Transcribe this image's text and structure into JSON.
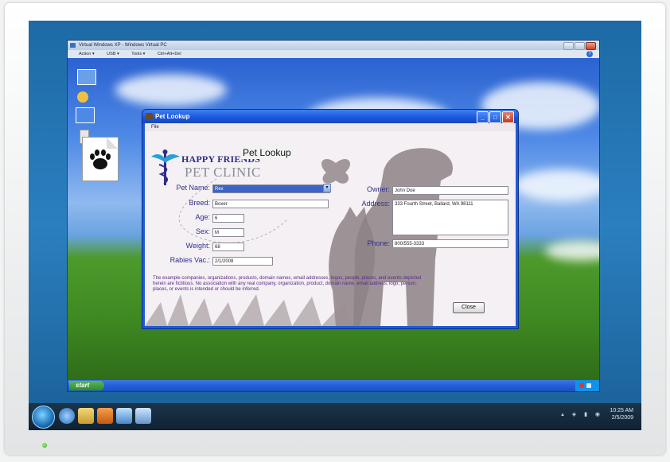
{
  "vpc": {
    "title": "Virtual Windows XP - Windows Virtual PC",
    "menus": [
      "Action ▾",
      "USB ▾",
      "Tools ▾",
      "Ctrl+Alt+Del"
    ]
  },
  "xp": {
    "start_label": "start"
  },
  "app": {
    "title": "Pet Lookup",
    "menu_file": "File",
    "heading": "Pet Lookup",
    "logo_line1": "HAPPY FRIENDS",
    "logo_line2": "PET CLINIC",
    "labels": {
      "pet_name": "Pet Name:",
      "breed": "Breed:",
      "age": "Age:",
      "sex": "Sex:",
      "weight": "Weight:",
      "rabies": "Rabies Vac.:",
      "owner": "Owner:",
      "address": "Address:",
      "phone": "Phone:"
    },
    "values": {
      "pet_name": "Rex",
      "breed": "Boxer",
      "age": "6",
      "sex": "M",
      "weight": "68",
      "rabies": "2/1/2008",
      "owner": "John Doe",
      "address": "333 Fourth Street, Ballard, WA 98111",
      "phone": "800/555-3333"
    },
    "disclaimer": "The example companies, organizations, products, domain names, email addresses, logos, people, places, and events depicted herein are fictitious. No association with any real company, organization, product, domain name, email address, logo, person, places, or events is intended or should be inferred.",
    "close_label": "Close"
  },
  "host": {
    "clock_time": "10:25 AM",
    "clock_date": "2/5/2009"
  },
  "colors": {
    "label_text": "#2f2f8a",
    "titlebar": "#1a55dc",
    "logo_text": "#2e2d86"
  }
}
